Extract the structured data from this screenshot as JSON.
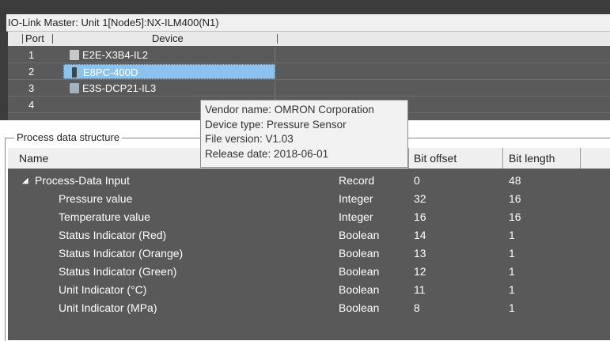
{
  "window": {
    "title": "IO-Link Master: Unit 1[Node5]:NX-ILM400(N1)"
  },
  "port_table": {
    "headers": {
      "port": "Port",
      "device": "Device"
    },
    "rows": [
      {
        "port": "1",
        "device": "E2E-X3B4-IL2",
        "icon": "proximity-sensor-icon"
      },
      {
        "port": "2",
        "device": "E8PC-400D",
        "icon": "pressure-sensor-icon",
        "selected": true
      },
      {
        "port": "3",
        "device": "E3S-DCP21-IL3",
        "icon": "photoelectric-sensor-icon"
      },
      {
        "port": "4",
        "device": "",
        "icon": ""
      }
    ]
  },
  "tooltip": {
    "vendor": "Vendor name: OMRON Corporation",
    "device_type": "Device type: Pressure Sensor",
    "file_version": "File version: V1.03",
    "release_date": "Release date: 2018-06-01"
  },
  "process_data": {
    "section_title": "Process data structure",
    "headers": {
      "name": "Name",
      "type": "",
      "bit_offset": "Bit offset",
      "bit_length": "Bit length"
    },
    "rows": [
      {
        "name": "Process-Data Input",
        "type": "Record",
        "offset": "0",
        "length": "48",
        "group": true
      },
      {
        "name": "Pressure value",
        "type": "Integer",
        "offset": "32",
        "length": "16"
      },
      {
        "name": "Temperature value",
        "type": "Integer",
        "offset": "16",
        "length": "16"
      },
      {
        "name": "Status Indicator (Red)",
        "type": "Boolean",
        "offset": "14",
        "length": "1"
      },
      {
        "name": "Status Indicator (Orange)",
        "type": "Boolean",
        "offset": "13",
        "length": "1"
      },
      {
        "name": "Status Indicator (Green)",
        "type": "Boolean",
        "offset": "12",
        "length": "1"
      },
      {
        "name": "Unit Indicator (°C)",
        "type": "Boolean",
        "offset": "11",
        "length": "1"
      },
      {
        "name": "Unit Indicator (MPa)",
        "type": "Boolean",
        "offset": "8",
        "length": "1"
      }
    ]
  },
  "colors": {
    "dark_background": "#595959",
    "selection": "#8cc3ee",
    "header_background": "#efefef"
  }
}
